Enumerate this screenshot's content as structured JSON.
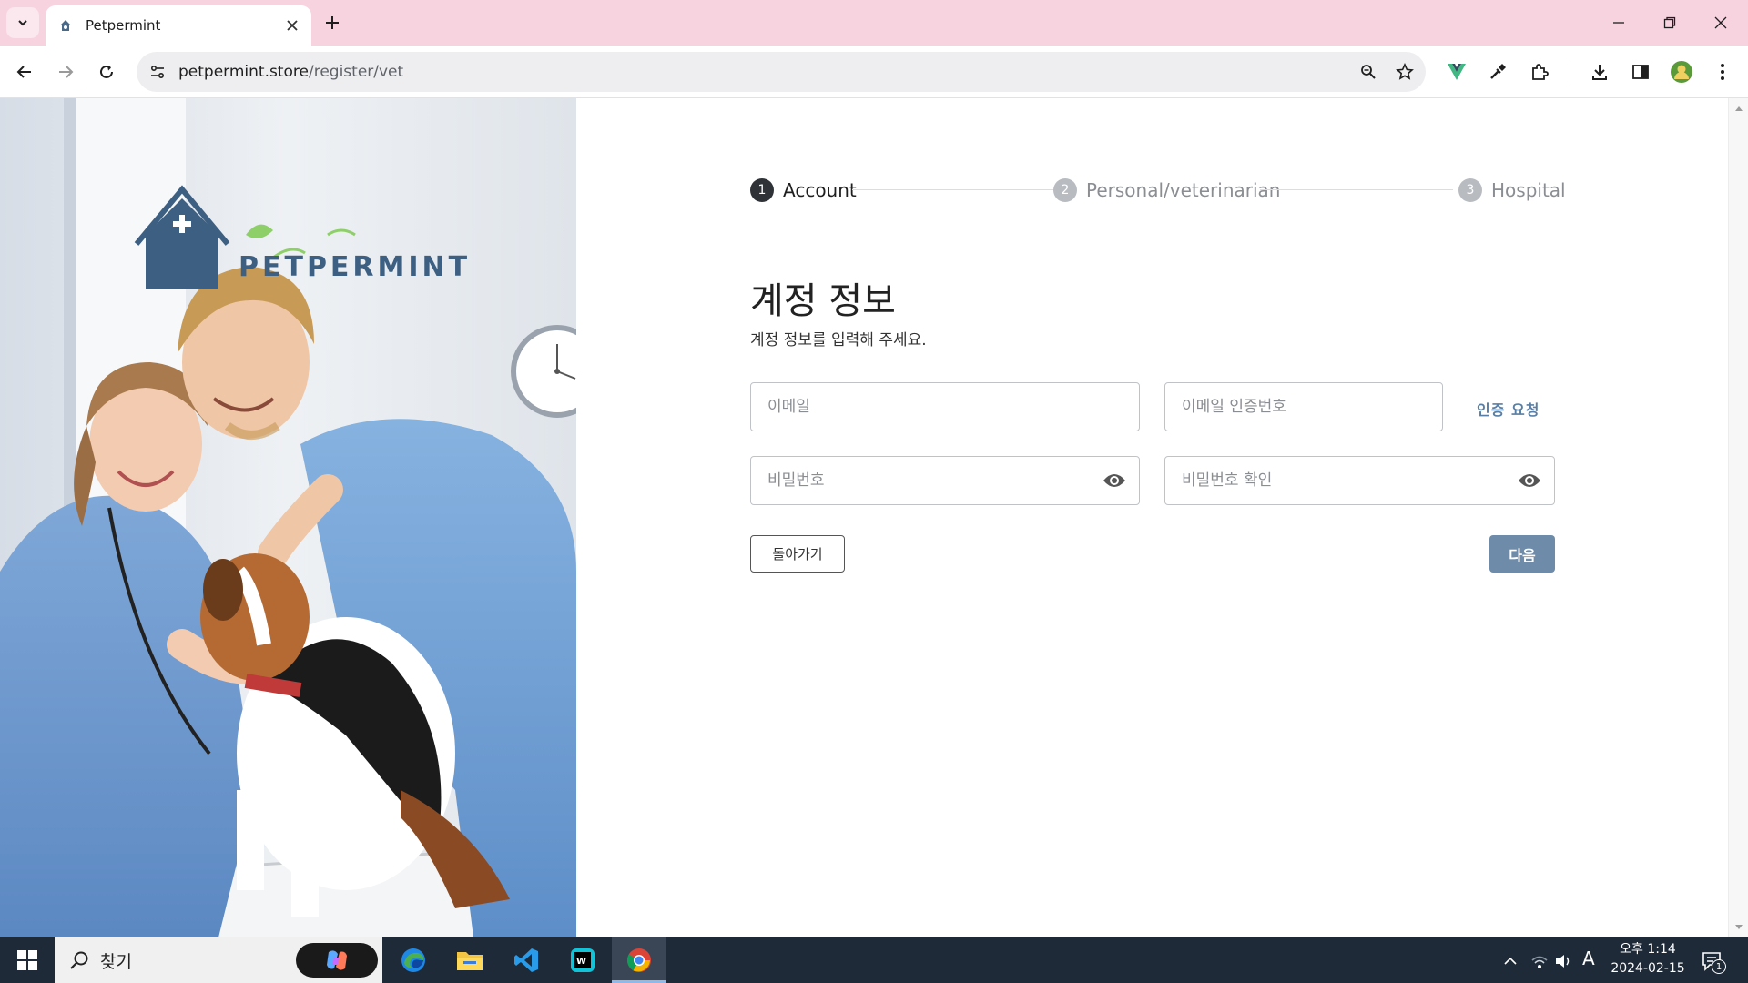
{
  "browser": {
    "tab_title": "Petpermint",
    "url_domain": "petpermint.store",
    "url_path": "/register/vet"
  },
  "hero": {
    "brand_name": "PETPERMINT"
  },
  "stepper": {
    "steps": [
      {
        "num": "1",
        "label": "Account"
      },
      {
        "num": "2",
        "label": "Personal/veterinarian"
      },
      {
        "num": "3",
        "label": "Hospital"
      }
    ]
  },
  "form": {
    "title": "계정 정보",
    "subtitle": "계정 정보를 입력해 주세요.",
    "email_placeholder": "이메일",
    "code_placeholder": "이메일 인증번호",
    "verify_label": "인증 요청",
    "password_placeholder": "비밀번호",
    "password_confirm_placeholder": "비밀번호 확인",
    "back_label": "돌아가기",
    "next_label": "다음"
  },
  "taskbar": {
    "search_text": "찾기",
    "ime": "A",
    "time": "오후 1:14",
    "date": "2024-02-15",
    "notification_count": "1"
  },
  "colors": {
    "tabbar_bg": "#f7d3e0",
    "accent": "#6e8ca9",
    "link": "#5a7fa5",
    "taskbar_bg": "#1e2a38"
  }
}
